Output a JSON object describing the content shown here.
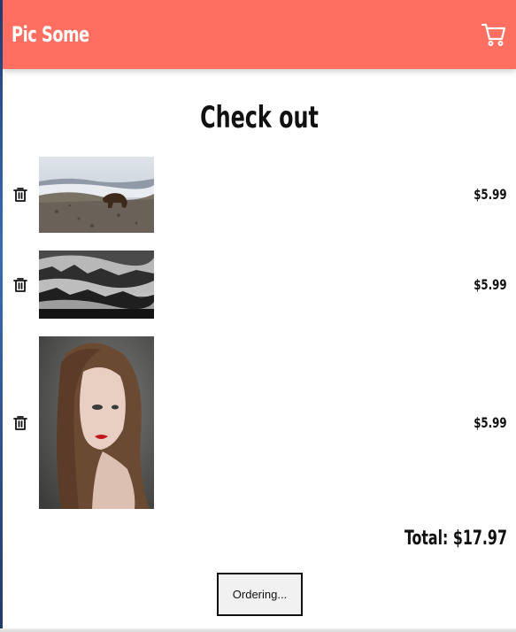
{
  "header": {
    "brand": "Pic Some",
    "cart_icon": "cart-icon"
  },
  "page": {
    "title": "Check out"
  },
  "cart": {
    "items": [
      {
        "image": "bear-on-rocky-hillside",
        "price": "$5.99",
        "remove_icon": "trash-icon"
      },
      {
        "image": "misty-forest-black-white",
        "price": "$5.99",
        "remove_icon": "trash-icon"
      },
      {
        "image": "woman-portrait-red-lips",
        "price": "$5.99",
        "remove_icon": "trash-icon"
      }
    ],
    "total": "Total: $17.97",
    "order_button": "Ordering..."
  },
  "colors": {
    "header_bg": "#ff6f61",
    "header_text": "#ffffff",
    "button_bg": "#f1f1f1"
  }
}
